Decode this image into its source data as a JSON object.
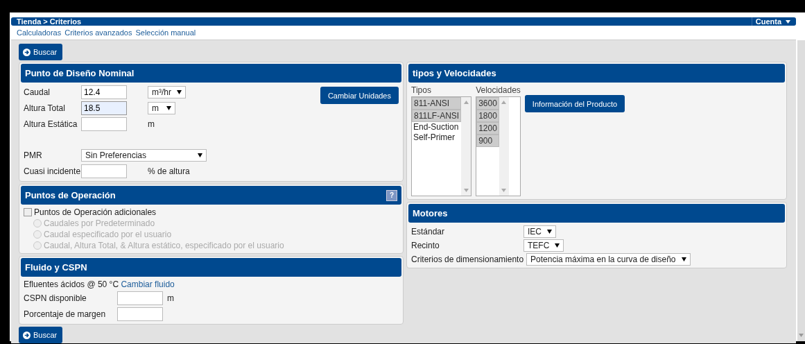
{
  "breadcrumb": "Tienda > Criterios",
  "account_menu": "Cuenta",
  "nav_links": [
    "Calculadoras",
    "Criterios avanzados",
    "Selección manual"
  ],
  "search_buttons": [
    "Buscar",
    "Buscar"
  ],
  "design_point": {
    "title": "Punto de Diseño Nominal",
    "change_units_button": "Cambiar Unidades",
    "fields": [
      {
        "label": "Caudal",
        "value": "12.4",
        "focused": false,
        "unit_select": "m³/hr"
      },
      {
        "label": "Altura Total",
        "value": "18.5",
        "focused": true,
        "unit_select": "m"
      },
      {
        "label": "Altura Estática",
        "focused": false,
        "unit": "m"
      }
    ],
    "pmr": {
      "label": "PMR",
      "value": "Sin Preferencias"
    },
    "near_miss": {
      "label": "Cuasi incidente",
      "unit": "% de altura"
    }
  },
  "operation_points": {
    "title": "Puntos de Operación",
    "help": "?",
    "checkbox": {
      "label": "Puntos de Operación adicionales",
      "checked": false
    },
    "options": [
      {
        "label": "Caudales por Predeterminado",
        "selected": false,
        "disabled": true
      },
      {
        "label": "Caudal especificado por el usuario",
        "selected": false,
        "disabled": true
      },
      {
        "label": "Caudal, Altura Total, & Altura estático, especificado por el usuario",
        "selected": false,
        "disabled": true
      }
    ]
  },
  "fluid": {
    "title": "Fluido y CSPN",
    "fluid_text": "Efluentes ácidos @ 50 °C",
    "change_link": "Cambiar fluido",
    "fields": [
      {
        "label": "CSPN disponible",
        "unit": "m"
      },
      {
        "label": "Porcentaje de margen"
      }
    ]
  },
  "types_speeds": {
    "title": "tipos y Velocidades",
    "product_button": "Información del Producto",
    "types": {
      "label": "Tipos",
      "items": [
        {
          "label": "811-ANSI",
          "selected": true
        },
        {
          "label": "811LF-ANSI",
          "selected": true
        },
        {
          "label": "End-Suction",
          "selected": false
        },
        {
          "label": "Self-Primer",
          "selected": false
        }
      ]
    },
    "speeds": {
      "label": "Velocidades",
      "items": [
        {
          "label": "3600",
          "selected": true
        },
        {
          "label": "1800",
          "selected": true
        },
        {
          "label": "1200",
          "selected": true
        },
        {
          "label": "900",
          "selected": true
        }
      ]
    }
  },
  "motors": {
    "title": "Motores",
    "fields": [
      {
        "label": "Estándar",
        "value": "IEC"
      },
      {
        "label": "Recinto",
        "value": "TEFC"
      },
      {
        "label": "Criterios de dimensionamiento",
        "value": "Potencia máxima en la curva de diseño"
      }
    ]
  }
}
